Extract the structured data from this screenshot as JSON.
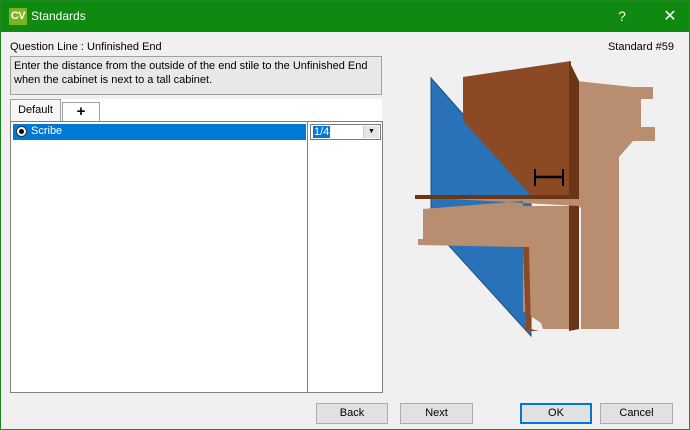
{
  "window": {
    "app_icon_text": "CV",
    "title": "Standards",
    "help_glyph": "?",
    "close_glyph": "✕",
    "accent": "#0f8a10"
  },
  "question_line": "Question Line : Unfinished End",
  "standard_number": "Standard #59",
  "description": "Enter the distance from the outside of the end stile to the Unfinished End when the cabinet is next to a tall cabinet.",
  "tabs": [
    {
      "label": "Default",
      "selected": true
    },
    {
      "label": "+",
      "icon": "plus-icon"
    }
  ],
  "options": [
    {
      "label": "Scribe",
      "selected": true,
      "value": "1/4"
    }
  ],
  "diagram": {
    "description_icon": "scribe-diagram",
    "colors": {
      "blue": "#2a72b8",
      "dark_wood": "#8b4a24",
      "light_wood": "#b98d70",
      "edge_wood": "#6b3615"
    }
  },
  "buttons": {
    "back": "Back",
    "next": "Next",
    "ok": "OK",
    "cancel": "Cancel"
  }
}
